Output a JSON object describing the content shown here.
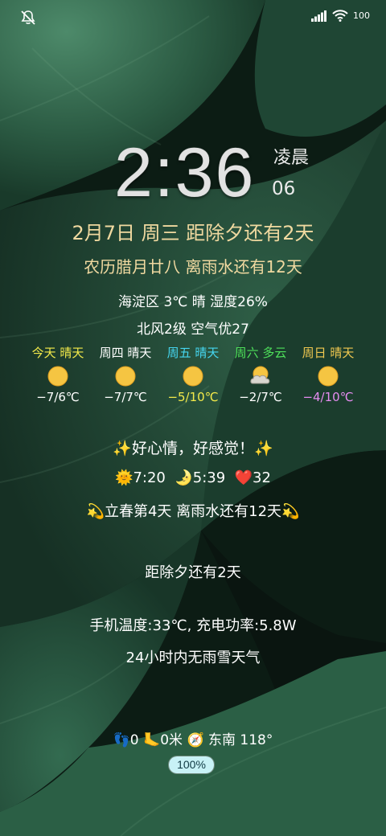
{
  "status_bar": {
    "left_icon": "notifications-muted-icon",
    "signal_icon": "cellular-signal-icon",
    "wifi_icon": "wifi-icon",
    "battery_level": "100"
  },
  "clock": {
    "time": "2:36",
    "period": "凌晨",
    "seconds": "06"
  },
  "date_line": "2月7日 周三 距除夕还有2天",
  "lunar_line": "农历腊月廿八 离雨水还有12天",
  "weather_now": "海淀区 3℃ 晴 湿度26%",
  "wind_line": "北风2级 空气优27",
  "forecast": [
    {
      "label": "今天 晴天",
      "icon": "sun-icon",
      "temp": "−7/6℃",
      "label_color": "#f3ea4a",
      "temp_color": "#ffffff"
    },
    {
      "label": "周四 晴天",
      "icon": "sun-icon",
      "temp": "−7/7℃",
      "label_color": "#ffffff",
      "temp_color": "#ffffff"
    },
    {
      "label": "周五 晴天",
      "icon": "sun-icon",
      "temp": "−5/10℃",
      "label_color": "#45d6f0",
      "temp_color": "#f3ea4a"
    },
    {
      "label": "周六 多云",
      "icon": "partly-cloudy-icon",
      "temp": "−2/7℃",
      "label_color": "#4ee05a",
      "temp_color": "#ffffff"
    },
    {
      "label": "周日 晴天",
      "icon": "sun-icon",
      "temp": "−4/10℃",
      "label_color": "#f0c850",
      "temp_color": "#e58cf0"
    }
  ],
  "mood": {
    "sparkle_left": "✨",
    "text": "好心情，好感觉！",
    "sparkle_right": "✨"
  },
  "sun_moon": {
    "sun_emoji": "🌞",
    "sunrise": "7:20",
    "moon_emoji": "🌛",
    "moonrise": "5:39",
    "heart_emoji": "❤️",
    "heart_rate": "32"
  },
  "season": {
    "emoji_left": "💫",
    "text": "立春第4天  离雨水还有12天",
    "emoji_right": "💫"
  },
  "countdown": "距除夕还有2天",
  "phone_temp": "手机温度:33℃, 充电功率:5.8W",
  "rain_line": "24小时内无雨雪天气",
  "steps": {
    "footprints_emoji": "👣",
    "steps_value": "0",
    "foot_emoji": "🦶",
    "distance": "0米",
    "compass_emoji": "🧭",
    "direction": "东南 118°"
  },
  "battery_pill": {
    "text": "100%",
    "fraction": 1.0,
    "color": "#c8f2f6"
  },
  "colors": {
    "background": "#0f2318",
    "leaf": "#2b5a42",
    "date_text": "#f0d9a0"
  }
}
